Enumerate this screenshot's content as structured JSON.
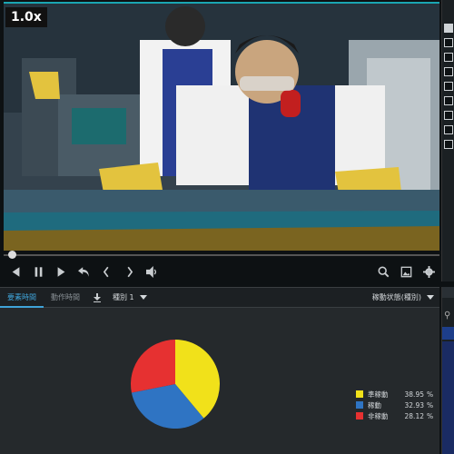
{
  "player": {
    "speed_label": "1.0x",
    "progress_fraction": 0.01,
    "controls_left": [
      "skip-back-icon",
      "pause-icon",
      "play-icon",
      "undo-icon",
      "prev-frame-icon",
      "next-frame-icon",
      "volume-icon"
    ],
    "controls_right": [
      "zoom-icon",
      "snapshot-icon",
      "settings-icon"
    ]
  },
  "side_panel": {
    "checkboxes": [
      true,
      false,
      false,
      false,
      false,
      false,
      false,
      false,
      false
    ]
  },
  "bottom_panel": {
    "tabs": [
      {
        "label": "要素時間",
        "active": true
      },
      {
        "label": "動作時間",
        "active": false
      }
    ],
    "category_dropdown": "種別 1",
    "status_dropdown": "稼動状態(種別)"
  },
  "chart_data": {
    "type": "pie",
    "title": "",
    "slices": [
      {
        "name": "準稼動",
        "value": 38.95,
        "color": "#f1e11a"
      },
      {
        "name": "稼動",
        "value": 32.93,
        "color": "#2f74c3"
      },
      {
        "name": "非稼動",
        "value": 28.12,
        "color": "#e63131"
      }
    ],
    "unit": "%",
    "start_angle_deg": 0,
    "legend_position": "right"
  }
}
